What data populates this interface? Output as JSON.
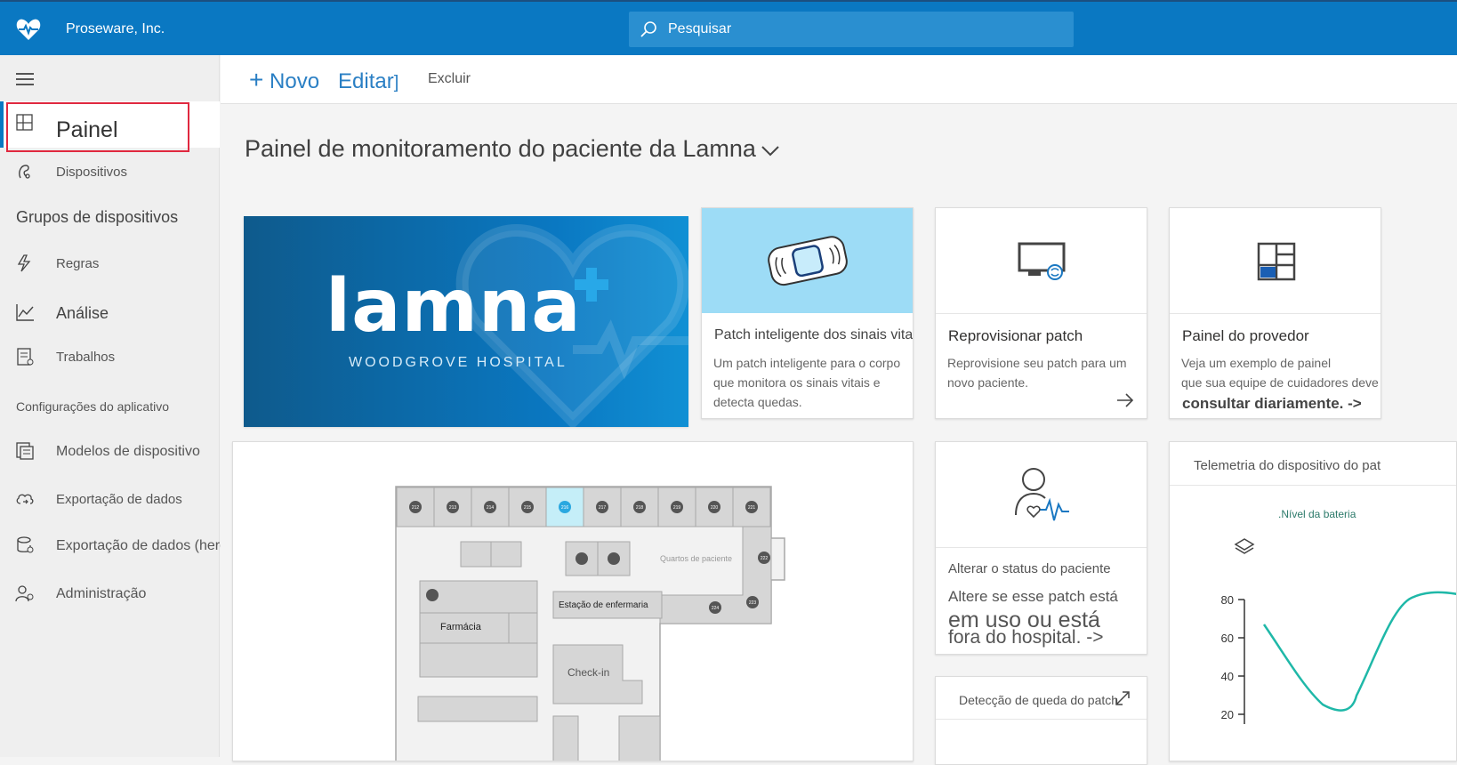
{
  "header": {
    "company": "Proseware, Inc.",
    "search_placeholder": "Pesquisar",
    "brand_color": "#0a78c2"
  },
  "sidebar": {
    "items": [
      {
        "label": "Painel",
        "icon": "dashboard-icon",
        "active": true
      },
      {
        "label": "Dispositivos",
        "icon": "devices-icon"
      },
      {
        "label": "Regras",
        "icon": "rules-icon"
      },
      {
        "label": "Análise",
        "icon": "analytics-icon"
      },
      {
        "label": "Trabalhos",
        "icon": "jobs-icon"
      },
      {
        "label": "Modelos de dispositivo",
        "icon": "device-templates-icon"
      },
      {
        "label": "Exportação de dados",
        "icon": "data-export-icon"
      },
      {
        "label": "Exportação de dados (herdado)",
        "icon": "data-export-legacy-icon"
      },
      {
        "label": "Administração",
        "icon": "administration-icon"
      }
    ],
    "sections": {
      "device_groups": "Grupos de dispositivos",
      "app_settings": "Configurações do aplicativo"
    }
  },
  "commands": {
    "new": "Novo",
    "edit": "Editar",
    "delete": "Excluir"
  },
  "dashboard": {
    "title": "Painel de monitoramento do paciente da Lamna"
  },
  "tiles": {
    "logo": {
      "brand": "lamna",
      "sub": "WOODGROVE HOSPITAL"
    },
    "patch": {
      "title": "Patch inteligente dos sinais vitais",
      "desc": [
        "Um patch inteligente para o corpo",
        "que monitora os sinais vitais e",
        "detecta quedas."
      ]
    },
    "reprovision": {
      "title": "Reprovisionar patch",
      "desc": [
        "Reprovisione seu patch para um",
        "novo paciente."
      ]
    },
    "provider": {
      "title": "Painel do provedor",
      "desc": [
        "Veja um exemplo de painel",
        "que sua equipe de cuidadores deve"
      ],
      "link": "consultar diariamente. ->"
    },
    "patient_status": {
      "title": "Alterar o status do paciente",
      "desc": "Altere se esse patch está",
      "big1": "em uso ou está",
      "big2": "fora do hospital. ->"
    },
    "fall_detect": {
      "title": "Detecção de queda do patch"
    },
    "telemetry": {
      "title": "Telemetria do dispositivo do pat",
      "series": ".Nível da bateria",
      "yticks": [
        "80",
        "60",
        "40",
        "20"
      ]
    },
    "floor": {
      "rooms": [
        "212",
        "213",
        "214",
        "215",
        "216",
        "217",
        "218",
        "219",
        "220",
        "221",
        "222",
        "223",
        "224"
      ],
      "labels": {
        "quartos": "Quartos de paciente",
        "estacao": "Estação de enfermaria",
        "farmacia": "Farmácia",
        "checkin": "Check-in"
      }
    }
  }
}
